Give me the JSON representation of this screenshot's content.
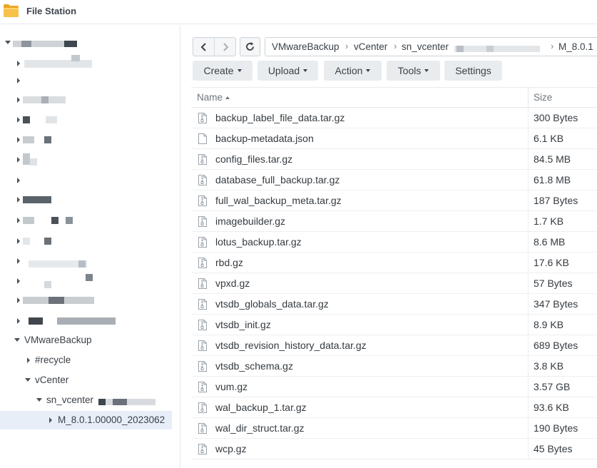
{
  "app": {
    "title": "File Station",
    "icon": "folder-icon",
    "accent": "#f5b73b"
  },
  "tree": {
    "vmware_backup": "VMwareBackup",
    "recycle": "#recycle",
    "vcenter": "vCenter",
    "sn_vcenter": "sn_vcenter",
    "selected_folder": "M_8.0.1.00000_2023062"
  },
  "toolbar": {
    "back_icon": "chevron-left-icon",
    "forward_icon": "chevron-right-icon",
    "refresh_icon": "refresh-icon",
    "create": "Create",
    "upload": "Upload",
    "action": "Action",
    "tools": "Tools",
    "settings": "Settings"
  },
  "path": {
    "crumbs": [
      "VMwareBackup",
      "vCenter",
      "sn_vcenter",
      "M_8.0.1"
    ],
    "separator": "›"
  },
  "list": {
    "columns": {
      "name": "Name",
      "size": "Size"
    },
    "sort_column": "Name",
    "sort_direction": "ascending",
    "files": [
      {
        "name": "backup_label_file_data.tar.gz",
        "size": "300 Bytes",
        "icon": "archive-file-icon"
      },
      {
        "name": "backup-metadata.json",
        "size": "6.1 KB",
        "icon": "blank-file-icon"
      },
      {
        "name": "config_files.tar.gz",
        "size": "84.5 MB",
        "icon": "archive-file-icon"
      },
      {
        "name": "database_full_backup.tar.gz",
        "size": "61.8 MB",
        "icon": "archive-file-icon"
      },
      {
        "name": "full_wal_backup_meta.tar.gz",
        "size": "187 Bytes",
        "icon": "archive-file-icon"
      },
      {
        "name": "imagebuilder.gz",
        "size": "1.7 KB",
        "icon": "archive-file-icon"
      },
      {
        "name": "lotus_backup.tar.gz",
        "size": "8.6 MB",
        "icon": "archive-file-icon"
      },
      {
        "name": "rbd.gz",
        "size": "17.6 KB",
        "icon": "archive-file-icon"
      },
      {
        "name": "vpxd.gz",
        "size": "57 Bytes",
        "icon": "archive-file-icon"
      },
      {
        "name": "vtsdb_globals_data.tar.gz",
        "size": "347 Bytes",
        "icon": "archive-file-icon"
      },
      {
        "name": "vtsdb_init.gz",
        "size": "8.9 KB",
        "icon": "archive-file-icon"
      },
      {
        "name": "vtsdb_revision_history_data.tar.gz",
        "size": "689 Bytes",
        "icon": "archive-file-icon"
      },
      {
        "name": "vtsdb_schema.gz",
        "size": "3.8 KB",
        "icon": "archive-file-icon"
      },
      {
        "name": "vum.gz",
        "size": "3.57 GB",
        "icon": "archive-file-icon"
      },
      {
        "name": "wal_backup_1.tar.gz",
        "size": "93.6 KB",
        "icon": "archive-file-icon"
      },
      {
        "name": "wal_dir_struct.tar.gz",
        "size": "190 Bytes",
        "icon": "archive-file-icon"
      },
      {
        "name": "wcp.gz",
        "size": "45 Bytes",
        "icon": "archive-file-icon"
      }
    ]
  }
}
